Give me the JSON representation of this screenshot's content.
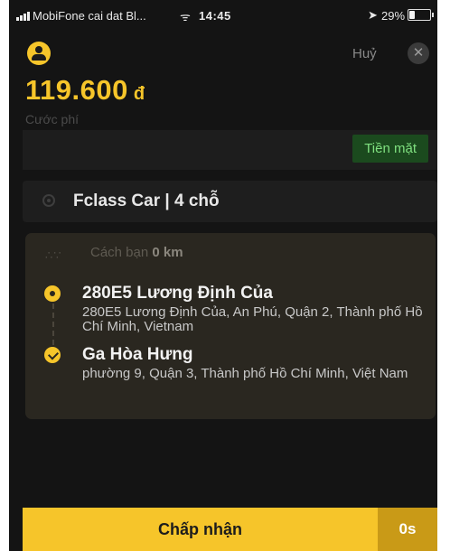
{
  "status_bar": {
    "carrier": "MobiFone cai dat Bl...",
    "time": "14:45",
    "battery": "29%",
    "battery_level": 0.29
  },
  "header": {
    "cancel_label": "Huỷ",
    "close_icon": "close-icon"
  },
  "fare": {
    "amount": "119.600",
    "currency": "đ",
    "label": "Cước phí"
  },
  "payment": {
    "method": "Tiền mặt",
    "chip_color": "#1b4a1e"
  },
  "vehicle": {
    "label": "Fclass Car | 4 chỗ"
  },
  "trip": {
    "distance_prefix": "Cách bạn",
    "distance_value": "0 km",
    "origin": {
      "title": "280E5 Lương Định Của",
      "address": "280E5 Lương Định Của, An Phú, Quận 2, Thành phố Hồ Chí Minh, Vietnam"
    },
    "destination": {
      "title": "Ga Hòa Hưng",
      "address": "phường 9, Quận 3, Thành phố Hồ Chí Minh, Việt Nam"
    }
  },
  "actions": {
    "accept_label": "Chấp nhận",
    "countdown": "0s"
  },
  "colors": {
    "accent": "#f6c52a",
    "background": "#141414",
    "cash_text": "#7fe07f"
  }
}
